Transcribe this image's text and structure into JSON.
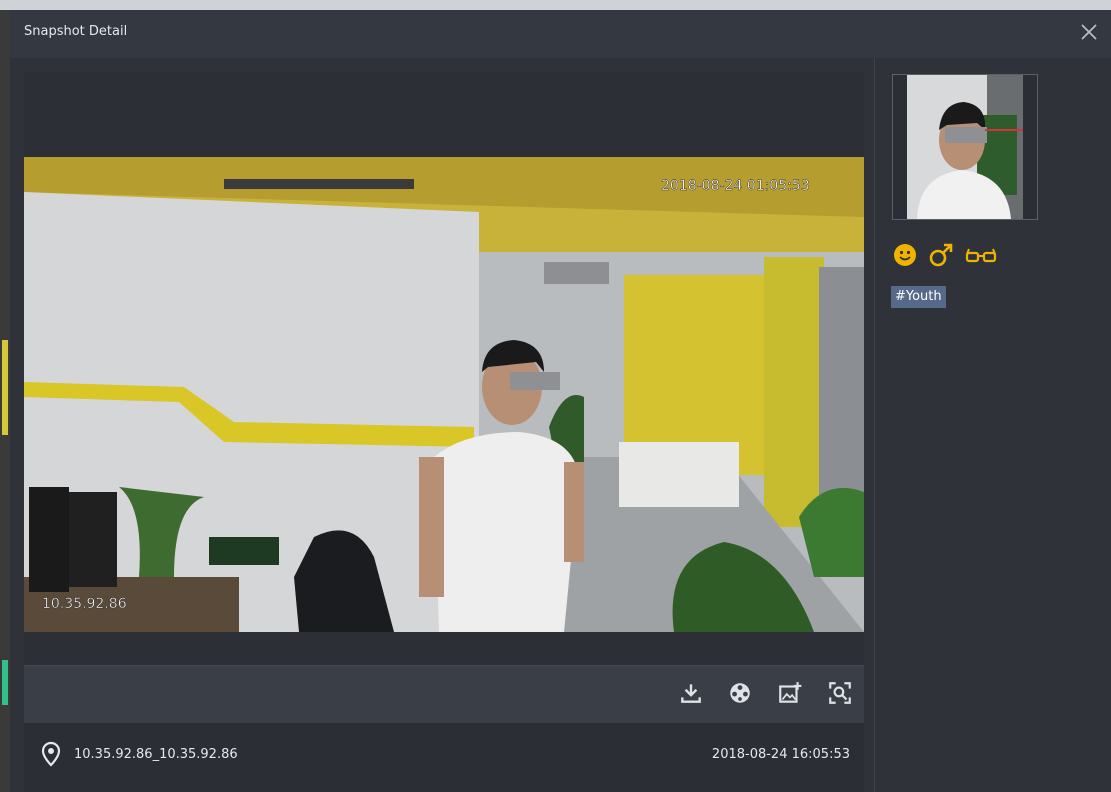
{
  "dialog": {
    "title": "Snapshot Detail",
    "close_icon": "close-icon"
  },
  "video": {
    "overlay_timestamp": "2018-08-24 01:05:53",
    "overlay_camera": "10.35.92.86"
  },
  "toolbar": {
    "items": [
      {
        "icon": "download-icon"
      },
      {
        "icon": "video-reel-icon"
      },
      {
        "icon": "add-picture-icon"
      },
      {
        "icon": "face-search-icon"
      }
    ]
  },
  "footer": {
    "location_icon": "location-pin-icon",
    "location": "10.35.92.86_10.35.92.86",
    "time": "2018-08-24 16:05:53"
  },
  "side": {
    "attributes": [
      {
        "icon": "smile-icon"
      },
      {
        "icon": "male-icon"
      },
      {
        "icon": "glasses-icon"
      }
    ],
    "tag": "#Youth"
  },
  "colors": {
    "accent": "#f0b400",
    "tag_bg": "#56698a"
  }
}
